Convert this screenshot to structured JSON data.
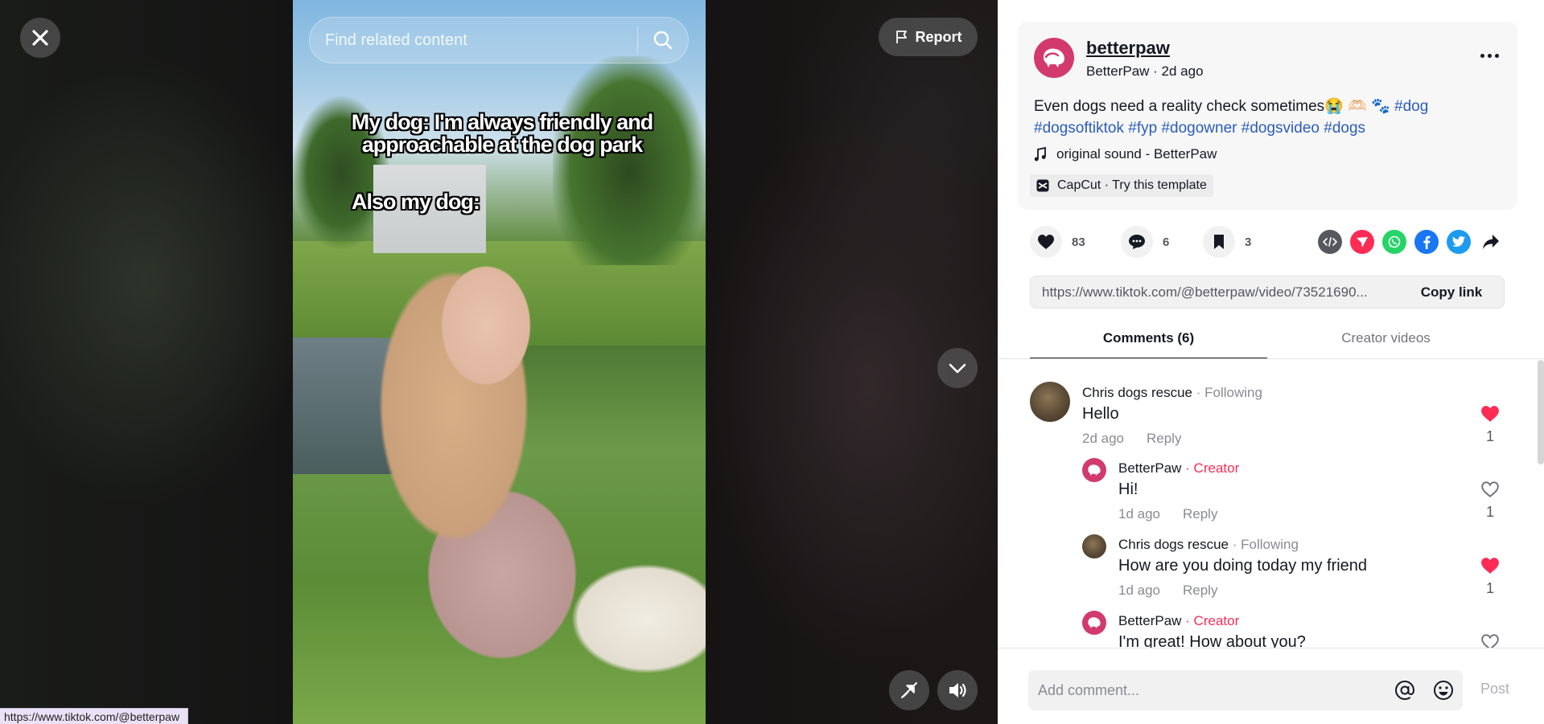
{
  "video": {
    "caption_line1": "My dog: I'm always friendly and approachable at the dog park",
    "caption_line2": "Also my dog:",
    "search_placeholder": "Find related content",
    "report_label": "Report",
    "status_url": "https://www.tiktok.com/@betterpaw"
  },
  "post": {
    "handle": "betterpaw",
    "sub": "BetterPaw · 2d ago",
    "desc_text": "Even dogs need a reality check sometimes😭 🫶🏻 🐾 ",
    "hashtags": [
      "#dog",
      "#dogsoftiktok",
      "#fyp",
      "#dogowner",
      "#dogsvideo",
      "#dogs"
    ],
    "sound": "original sound - BetterPaw",
    "capcut": "CapCut · Try this template"
  },
  "actions": {
    "likes": "83",
    "comments": "6",
    "saves": "3"
  },
  "share_icons": [
    {
      "name": "embed-icon",
      "color": "#57585e"
    },
    {
      "name": "send-icon",
      "color": "#fe2c55"
    },
    {
      "name": "whatsapp-icon",
      "color": "#25d366"
    },
    {
      "name": "facebook-icon",
      "color": "#1877f2"
    },
    {
      "name": "twitter-icon",
      "color": "#1d9bf0"
    },
    {
      "name": "share-arrow-icon",
      "color": "#161823"
    }
  ],
  "link": {
    "url": "https://www.tiktok.com/@betterpaw/video/73521690...",
    "copy_label": "Copy link"
  },
  "tabs": {
    "comments": "Comments (6)",
    "creator": "Creator videos"
  },
  "comments": [
    {
      "name": "Chris dogs rescue",
      "meta": " · Following",
      "text": "Hello",
      "time": "2d ago",
      "reply": "Reply",
      "likes": "1",
      "liked": true
    },
    {
      "name": "BetterPaw",
      "meta": " · Creator",
      "text": "Hi!",
      "time": "1d ago",
      "reply": "Reply",
      "likes": "1",
      "liked": false
    },
    {
      "name": "Chris dogs rescue",
      "meta": " · Following",
      "text": "How are you doing today my friend",
      "time": "1d ago",
      "reply": "Reply",
      "likes": "1",
      "liked": true
    },
    {
      "name": "BetterPaw",
      "meta": " · Creator",
      "text": "I'm great! How about you?",
      "time": "",
      "reply": "",
      "likes": "",
      "liked": false
    }
  ],
  "composer": {
    "placeholder": "Add comment...",
    "post_label": "Post"
  },
  "colors": {
    "accent": "#fe2c55",
    "brand": "#d23a6e",
    "hashtag": "#2b5db9"
  }
}
